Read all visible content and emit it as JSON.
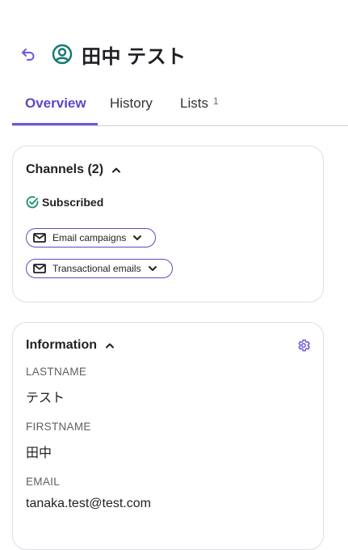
{
  "header": {
    "back_icon": "back-arrow-icon",
    "avatar_icon": "user-circle-icon",
    "title": "田中 テスト"
  },
  "tabs": [
    {
      "label": "Overview",
      "active": true
    },
    {
      "label": "History",
      "active": false
    },
    {
      "label": "Lists",
      "count": "1",
      "active": false
    }
  ],
  "channels": {
    "title": "Channels (2)",
    "status": "Subscribed",
    "pills": [
      {
        "label": "Email campaigns"
      },
      {
        "label": "Transactional emails"
      }
    ]
  },
  "information": {
    "title": "Information",
    "fields": [
      {
        "label": "LASTNAME",
        "value": "テスト"
      },
      {
        "label": "FIRSTNAME",
        "value": "田中"
      },
      {
        "label": "EMAIL",
        "value": "tanaka.test@test.com"
      }
    ]
  },
  "colors": {
    "accent": "#6a5ae0",
    "avatar": "#0f7a6c",
    "success": "#1a8f6a",
    "border": "#dedfe4"
  }
}
